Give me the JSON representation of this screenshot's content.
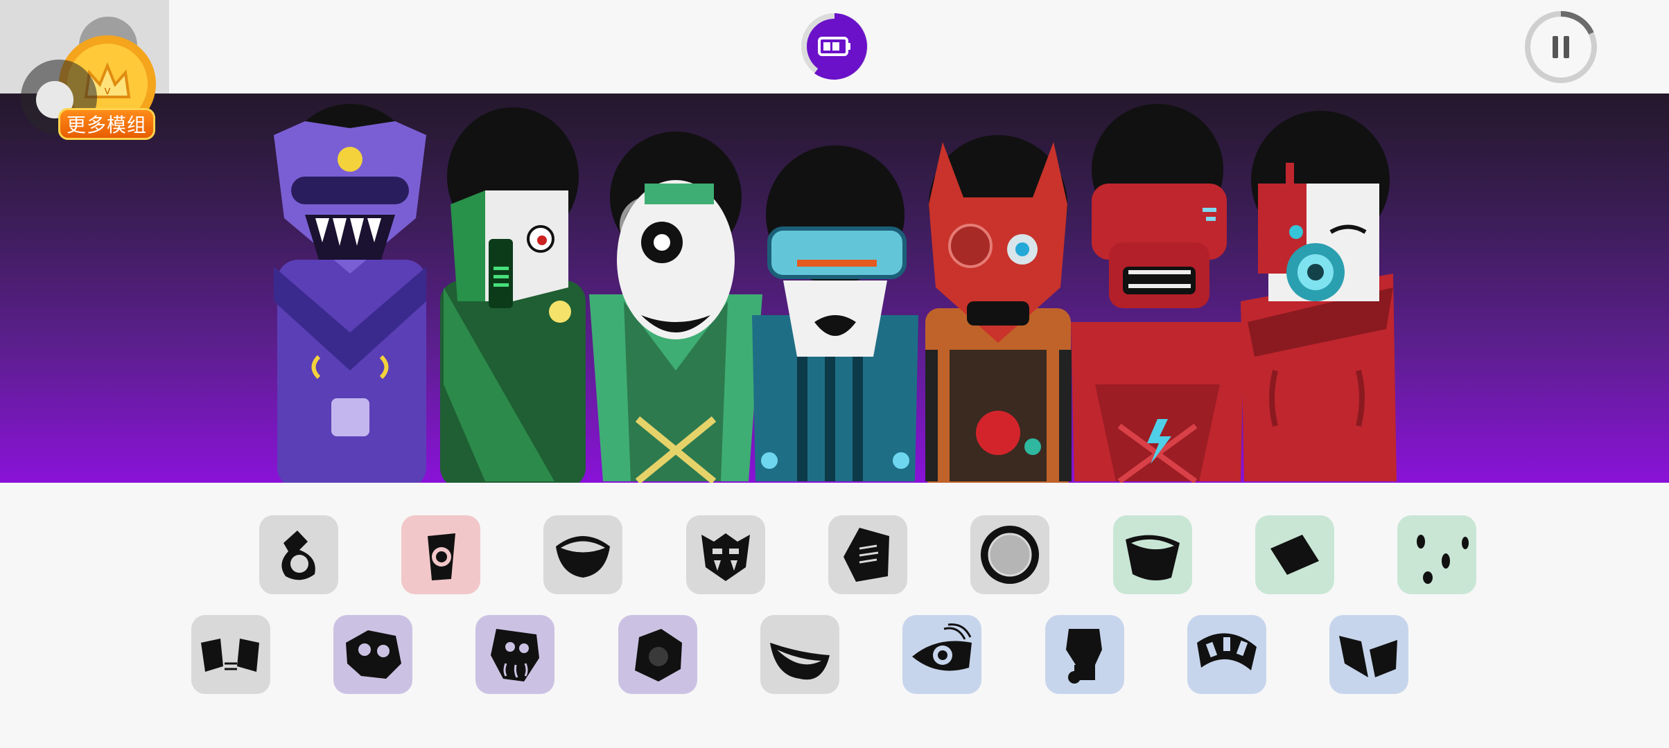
{
  "header": {
    "battery_button": {
      "icon": "battery-icon",
      "color": "#6a11c9"
    },
    "pause_button": {
      "icon": "pause-icon"
    },
    "more_mods": {
      "label": "更多模组",
      "icon": "crown-coin-icon"
    }
  },
  "stage": {
    "characters": [
      {
        "name": "purple-demon",
        "color": "#6b47c9"
      },
      {
        "name": "green-masked",
        "color": "#1f6b3a"
      },
      {
        "name": "green-skull",
        "color": "#3fae74"
      },
      {
        "name": "teal-visor",
        "color": "#1e6f86"
      },
      {
        "name": "red-horned",
        "color": "#c23a2c"
      },
      {
        "name": "red-helmet",
        "color": "#b7262b"
      },
      {
        "name": "red-respirator",
        "color": "#c0262e"
      }
    ]
  },
  "sound_palette": {
    "row1": [
      {
        "icon": "hook-sound-icon",
        "tint": "gray"
      },
      {
        "icon": "cup-sound-icon",
        "tint": "pink"
      },
      {
        "icon": "bowl-sound-icon",
        "tint": "gray"
      },
      {
        "icon": "fang-face-sound-icon",
        "tint": "gray"
      },
      {
        "icon": "hexagon-grill-sound-icon",
        "tint": "gray"
      },
      {
        "icon": "sun-gear-sound-icon",
        "tint": "gray"
      },
      {
        "icon": "basin-sound-icon",
        "tint": "green"
      },
      {
        "icon": "square-sound-icon",
        "tint": "green"
      },
      {
        "icon": "droplets-sound-icon",
        "tint": "green"
      }
    ],
    "row2": [
      {
        "icon": "goggles-sound-icon",
        "tint": "gray"
      },
      {
        "icon": "skull-mask-sound-icon",
        "tint": "purple"
      },
      {
        "icon": "octopus-sound-icon",
        "tint": "purple"
      },
      {
        "icon": "flower-sound-icon",
        "tint": "purple"
      },
      {
        "icon": "smile-sound-icon",
        "tint": "gray"
      },
      {
        "icon": "eye-sound-icon",
        "tint": "blue"
      },
      {
        "icon": "plug-sound-icon",
        "tint": "blue"
      },
      {
        "icon": "striped-band-sound-icon",
        "tint": "blue"
      },
      {
        "icon": "wing-sound-icon",
        "tint": "blue"
      }
    ]
  }
}
